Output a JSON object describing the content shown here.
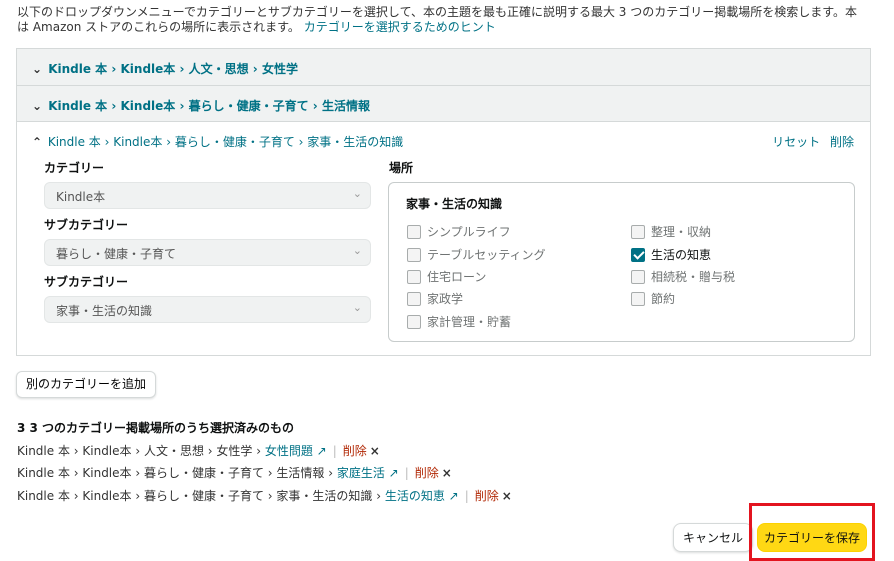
{
  "intro": {
    "text": "以下のドロップダウンメニューでカテゴリーとサブカテゴリーを選択して、本の主題を最も正確に説明する最大 3 つのカテゴリー掲載場所を検索します。本は Amazon ストアのこれらの場所に表示されます。",
    "hint_link": "カテゴリーを選択するためのヒント"
  },
  "accordion": [
    {
      "path": [
        "Kindle 本",
        "Kindle本",
        "人文・思想",
        "女性学"
      ]
    },
    {
      "path": [
        "Kindle 本",
        "Kindle本",
        "暮らし・健康・子育て",
        "生活情報"
      ]
    }
  ],
  "panel": {
    "path": [
      "Kindle 本",
      "Kindle本",
      "暮らし・健康・子育て",
      "家事・生活の知識"
    ],
    "reset": "リセット",
    "delete": "削除",
    "category_label": "カテゴリー",
    "category_value": "Kindle本",
    "subcategory_label": "サブカテゴリー",
    "subcategory1_value": "暮らし・健康・子育て",
    "subcategory2_label": "サブカテゴリー",
    "subcategory2_value": "家事・生活の知識",
    "place_label": "場所",
    "place_title": "家事・生活の知識",
    "options": [
      {
        "label": "シンプルライフ",
        "checked": false
      },
      {
        "label": "整理・収納",
        "checked": false
      },
      {
        "label": "テーブルセッティング",
        "checked": false
      },
      {
        "label": "生活の知恵",
        "checked": true
      },
      {
        "label": "住宅ローン",
        "checked": false
      },
      {
        "label": "相続税・贈与税",
        "checked": false
      },
      {
        "label": "家政学",
        "checked": false
      },
      {
        "label": "節約",
        "checked": false
      },
      {
        "label": "家計管理・貯蓄",
        "checked": false
      }
    ]
  },
  "add_button": "別のカテゴリーを追加",
  "selected": {
    "title": "3 3 つのカテゴリー掲載場所のうち選択済みのもの",
    "rows": [
      {
        "path": "Kindle 本 › Kindle本 › 人文・思想 › 女性学 › ",
        "leaf": "女性問題 ↗",
        "delete": "削除"
      },
      {
        "path": "Kindle 本 › Kindle本 › 暮らし・健康・子育て › 生活情報 › ",
        "leaf": "家庭生活 ↗",
        "delete": "削除"
      },
      {
        "path": "Kindle 本 › Kindle本 › 暮らし・健康・子育て › 家事・生活の知識 › ",
        "leaf": "生活の知恵 ↗",
        "delete": "削除"
      }
    ]
  },
  "footer": {
    "cancel": "キャンセル",
    "save": "カテゴリーを保存"
  },
  "colors": {
    "link": "#007185",
    "save_button": "#ffd814",
    "highlight": "#e3141f",
    "delete": "#b12704"
  },
  "icons": {
    "collapsed": "chevron-down-icon",
    "expanded": "chevron-up-icon",
    "select_caret": "caret-down-icon",
    "external": "external-link-icon",
    "remove": "close-icon"
  }
}
